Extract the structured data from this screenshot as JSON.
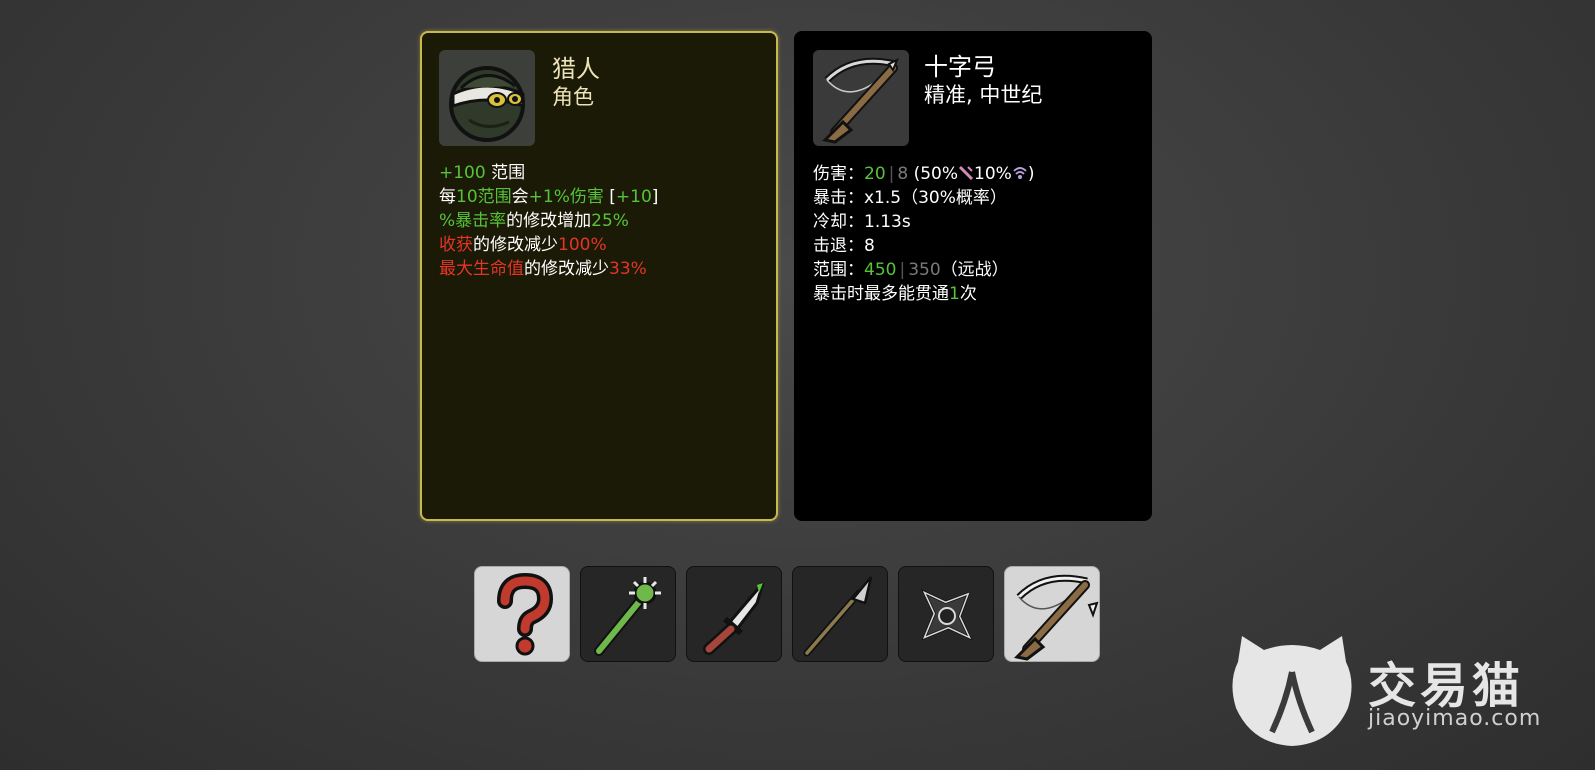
{
  "character": {
    "name": "猎人",
    "type": "角色",
    "portrait_icon": "hunter-masked-face-icon",
    "border_color": "#c9b94a",
    "stats": {
      "range_plus": "+100",
      "range_label": "范围",
      "per_prefix": "每",
      "per_value": "10范围",
      "per_mid": "会",
      "per_dmg": "+1%伤害",
      "per_bracket_open": "[",
      "per_bracket_val": "+10",
      "per_bracket_close": "]",
      "crit_stat": "%暴击率",
      "crit_mid": "的修改增加",
      "crit_val": "25%",
      "harvest_stat": "收获",
      "harvest_mid": "的修改减少",
      "harvest_val": "100%",
      "hp_stat": "最大生命值",
      "hp_mid": "的修改减少",
      "hp_val": "33%"
    }
  },
  "weapon": {
    "name": "十字弓",
    "tags": "精准, 中世纪",
    "portrait_icon": "crossbow-icon",
    "stats": {
      "damage_label": "伤害：",
      "damage_value": "20",
      "damage_base": "8",
      "damage_open": "(50%",
      "damage_mid": "10%",
      "damage_close": ")",
      "crit_label": "暴击：",
      "crit_value": "x1.5（30%概率）",
      "cooldown_label": "冷却：",
      "cooldown_value": "1.13s",
      "knockback_label": "击退：",
      "knockback_value": "8",
      "range_label": "范围：",
      "range_value": "450",
      "range_base": "350",
      "range_type": "（远战）",
      "pierce_prefix": "暴击时最多能贯通",
      "pierce_value": "1",
      "pierce_suffix": "次"
    }
  },
  "slots": [
    {
      "icon": "question-mark-icon",
      "style": "light"
    },
    {
      "icon": "spiked-club-icon",
      "style": "dark"
    },
    {
      "icon": "knife-icon",
      "style": "dark"
    },
    {
      "icon": "spear-icon",
      "style": "dark"
    },
    {
      "icon": "shuriken-icon",
      "style": "dark"
    },
    {
      "icon": "crossbow-icon",
      "style": "light"
    }
  ],
  "watermark": {
    "brand": "交易猫",
    "url": "jiaoyimao.com"
  },
  "colors": {
    "positive": "#58c23a",
    "negative": "#e53526",
    "base_value": "#7a7a7a"
  }
}
